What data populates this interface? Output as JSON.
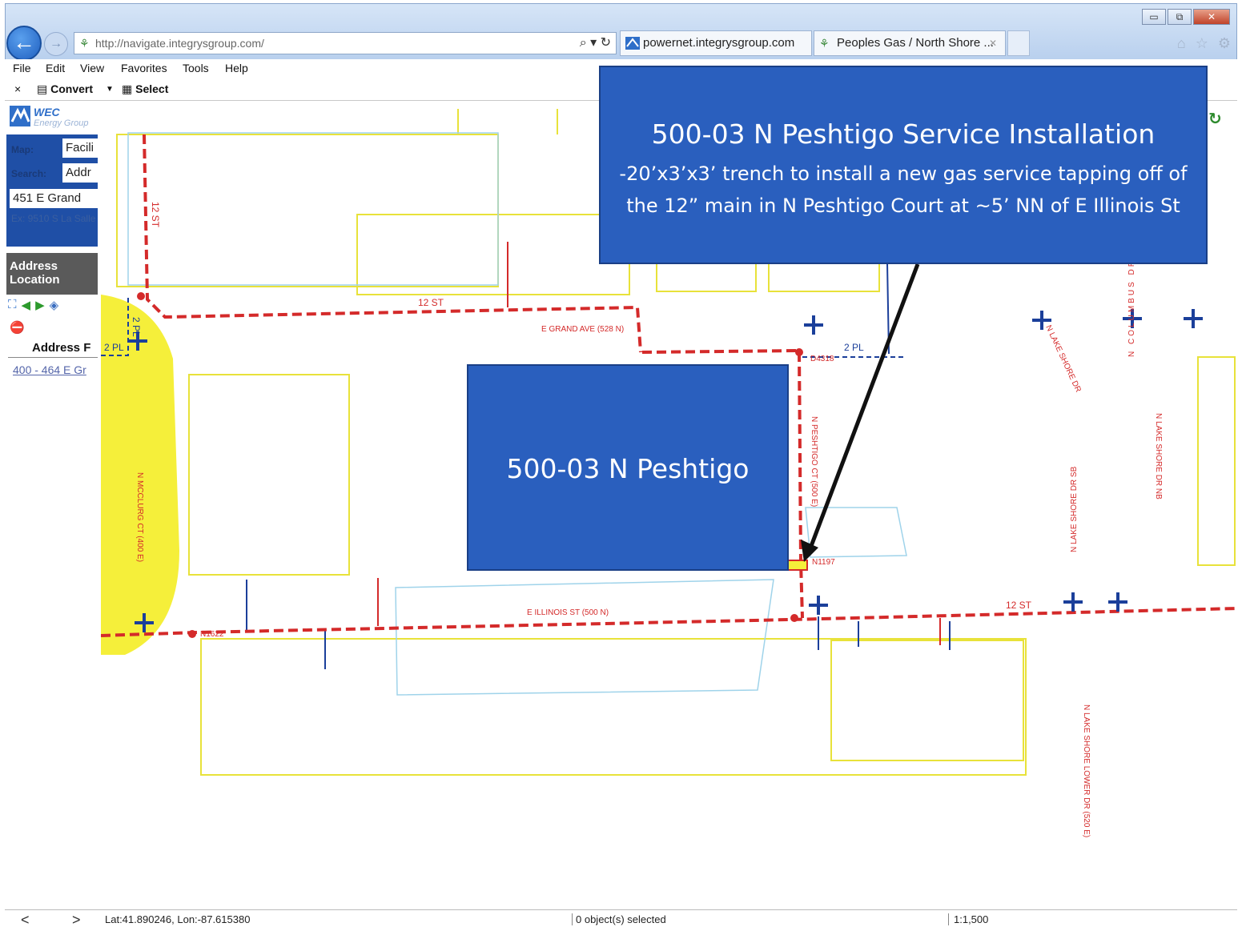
{
  "browser": {
    "url": "http://navigate.integrysgroup.com/",
    "tabs": [
      {
        "label": "powernet.integrysgroup.com"
      },
      {
        "label": "Peoples Gas / North Shore ..."
      }
    ],
    "window_controls": {
      "minimize": "▭",
      "maximize": "⧉",
      "close": "✕"
    },
    "menu": [
      "File",
      "Edit",
      "View",
      "Favorites",
      "Tools",
      "Help"
    ],
    "commands": {
      "close": "×",
      "convert": "Convert",
      "select": "Select"
    }
  },
  "left_panel": {
    "logo_text": "WEC",
    "logo_sub": "Energy Group",
    "map_label": "Map:",
    "map_value": "Facili",
    "search_label": "Search:",
    "search_value": "Addr",
    "address_input": "451 E Grand",
    "result_hint": "Ex: 9510 S La Salle",
    "address_location": "Address Location",
    "address_field_label": "Address F",
    "address_result": "400 - 464 E Gr"
  },
  "map": {
    "street_labels": {
      "grand": "E GRAND AVE (528 N)",
      "illinois": "E ILLINOIS ST (500 N)",
      "mcclurg": "N MCCLURG CT (400 E)",
      "peshtigo": "N PESHTIGO CT (500 E)",
      "lake_shore": "N LAKE SHORE DR",
      "lake_shore_sb": "N LAKE SHORE DR SB",
      "lake_shore_nb": "N LAKE SHORE DR NB",
      "lake_shore_lower": "N LAKE SHORE LOWER DR (520 E)",
      "columbus": "N COLUMBUS DR",
      "columbus_short": "N COLUMBUS DR"
    },
    "pipe_labels": {
      "twelve_st_top": "12 ST",
      "twelve_st_vertical": "12 ST",
      "twelve_st_right": "12 ST",
      "two_pl_left": "2 PL",
      "two_pl_vertical": "2 PL",
      "two_pl_right": "2 PL",
      "node_d4318": "D4318",
      "node_n1197": "N1197",
      "node_n1622": "N1622"
    },
    "colors": {
      "gas_main": "#d42a2a",
      "service": "#1b3f9a",
      "parcel": "#e8e23a",
      "building": "#9fd3ea",
      "highlight": "#f5ef3a"
    }
  },
  "callout": {
    "title": "500-03 N Peshtigo Service Installation",
    "body": "-20’x3’x3’ trench to install a new gas service tapping off of the 12” main in N Peshtigo Court at ~5’ NN of E Illinois St"
  },
  "building_label": "500-03 N Peshtigo",
  "status": {
    "prev": "<",
    "next": ">",
    "latlon": "Lat:41.890246, Lon:-87.615380",
    "selected": "0 object(s) selected",
    "scale": "1:1,500"
  }
}
